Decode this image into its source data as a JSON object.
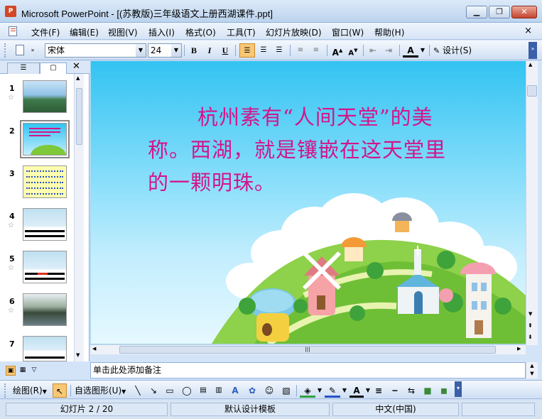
{
  "window": {
    "title": "Microsoft PowerPoint - [(苏教版)三年级语文上册西湖课件.ppt]",
    "app_icon_label": "P",
    "doc_close": "×"
  },
  "menu": [
    "文件(F)",
    "编辑(E)",
    "视图(V)",
    "插入(I)",
    "格式(O)",
    "工具(T)",
    "幻灯片放映(D)",
    "窗口(W)",
    "帮助(H)"
  ],
  "toolbar": {
    "font": "宋体",
    "size": "24",
    "bold": "B",
    "italic": "I",
    "underline": "U",
    "design": "设计(S)",
    "font_color_label": "A"
  },
  "thumbnails": [
    {
      "num": "1",
      "star": "☆"
    },
    {
      "num": "2",
      "star": ""
    },
    {
      "num": "3",
      "star": ""
    },
    {
      "num": "4",
      "star": "☆"
    },
    {
      "num": "5",
      "star": "☆"
    },
    {
      "num": "6",
      "star": "☆"
    },
    {
      "num": "7",
      "star": ""
    }
  ],
  "slide": {
    "text": "杭州素有“人间天堂”的美称。西湖，就是镶嵌在这天堂里的一颗明珠。"
  },
  "notes": {
    "placeholder": "单击此处添加备注"
  },
  "drawbar": {
    "draw": "绘图(R)",
    "autoshapes": "自选图形(U)"
  },
  "status": {
    "slide": "幻灯片 2 / 20",
    "template": "默认设计模板",
    "language": "中文(中国)"
  },
  "colors": {
    "slide_text": "#d4148a",
    "accent": "#d24726"
  }
}
